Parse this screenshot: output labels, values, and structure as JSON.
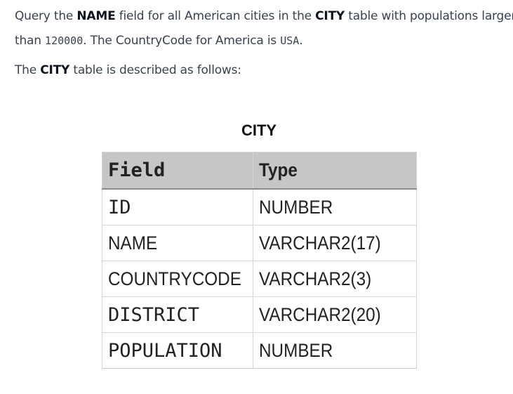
{
  "problem": {
    "p1": {
      "t1": "Query the ",
      "b1": "NAME",
      "t2": " field for all American cities in the ",
      "b2": "CITY",
      "t3": " table with populations larger",
      "t4": "than ",
      "c1": "120000",
      "t5": ". The CountryCode for America is ",
      "c2": "USA",
      "t6": "."
    },
    "p2": {
      "t1": "The ",
      "b1": "CITY",
      "t2": " table is described as follows:"
    }
  },
  "table": {
    "caption": "CITY",
    "headers": [
      "Field",
      "Type"
    ],
    "rows": [
      [
        "ID",
        "NUMBER"
      ],
      [
        "NAME",
        "VARCHAR2(17)"
      ],
      [
        "COUNTRYCODE",
        "VARCHAR2(3)"
      ],
      [
        "DISTRICT",
        "VARCHAR2(20)"
      ],
      [
        "POPULATION",
        "NUMBER"
      ]
    ]
  }
}
